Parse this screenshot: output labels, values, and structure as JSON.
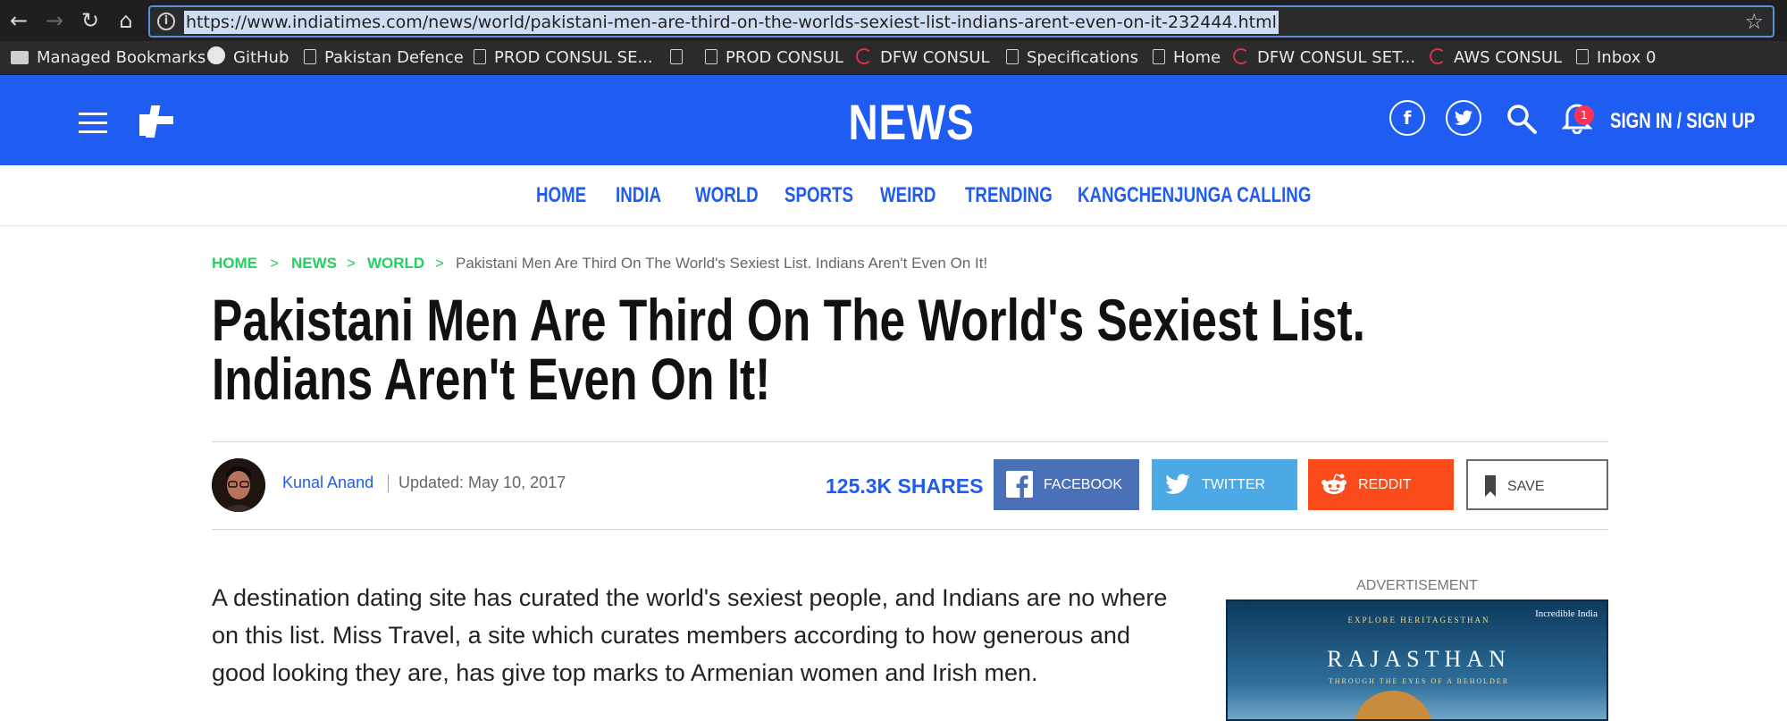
{
  "browser": {
    "url": "https://www.indiatimes.com/news/world/pakistani-men-are-third-on-the-worlds-sexiest-list-indians-arent-even-on-it-232444.html",
    "bookmarks": [
      {
        "label": "Managed Bookmarks",
        "icon": "folder-icon"
      },
      {
        "label": "GitHub",
        "icon": "github-icon"
      },
      {
        "label": "Pakistan Defence",
        "icon": "page-icon"
      },
      {
        "label": "PROD CONSUL SE...",
        "icon": "page-icon"
      },
      {
        "label": "",
        "icon": "page-icon"
      },
      {
        "label": "PROD CONSUL",
        "icon": "page-icon"
      },
      {
        "label": "DFW CONSUL",
        "icon": "consul-icon"
      },
      {
        "label": "Specifications",
        "icon": "page-icon"
      },
      {
        "label": "Home",
        "icon": "page-icon"
      },
      {
        "label": "DFW CONSUL SET...",
        "icon": "consul-icon"
      },
      {
        "label": "AWS CONSUL",
        "icon": "consul-icon"
      },
      {
        "label": "Inbox 0",
        "icon": "page-icon"
      }
    ]
  },
  "header": {
    "site_title": "NEWS",
    "signin": "SIGN IN / SIGN UP",
    "notification_count": "1",
    "brand_color": "#1f5cf2"
  },
  "nav": {
    "items": [
      "HOME",
      "INDIA",
      "WORLD",
      "SPORTS",
      "WEIRD",
      "TRENDING",
      "KANGCHENJUNGA CALLING"
    ]
  },
  "breadcrumb": {
    "home": "HOME",
    "news": "NEWS",
    "world": "WORLD",
    "current": "Pakistani Men Are Third On The World's Sexiest List. Indians Aren't Even On It!"
  },
  "article": {
    "headline": "Pakistani Men Are Third On The World's Sexiest List. Indians Aren't Even On It!",
    "author": "Kunal Anand",
    "updated": "Updated: May 10, 2017",
    "shares": "125.3K SHARES",
    "body": "A destination dating site has curated the world's sexiest people, and Indians are no where on this list. Miss Travel, a site which curates members according to how generous and good looking they are, has give top marks to Armenian women and Irish men."
  },
  "share": {
    "facebook": "FACEBOOK",
    "twitter": "TWITTER",
    "reddit": "REDDIT",
    "save": "SAVE"
  },
  "ad": {
    "label": "ADVERTISEMENT",
    "brand": "Incredible India",
    "sub": "EXPLORE HERITAGESTHAN",
    "title": "RAJASTHAN",
    "tag": "THROUGH THE EYES OF A BEHOLDER"
  }
}
